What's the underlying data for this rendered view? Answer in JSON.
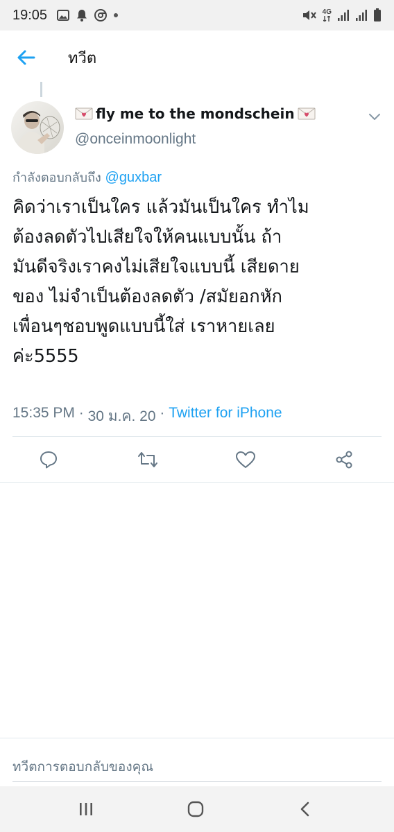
{
  "status_bar": {
    "time": "19:05",
    "network": "4G",
    "icons": [
      "image-icon",
      "bell-icon",
      "chrome-icon",
      "dot-icon",
      "mute-icon",
      "4g-icon",
      "signal-icon",
      "signal-icon",
      "battery-icon"
    ]
  },
  "header": {
    "title": "ทวีต",
    "back_icon": "arrow-left-icon"
  },
  "tweet": {
    "display_name": "fly me to the mondschein",
    "handle": "@onceinmoonlight",
    "reply_prefix": "กำลังตอบกลับถึง",
    "reply_mention": "@guxbar",
    "text_lines": [
      "คิดว่าเราเป็นใคร แล้วมันเป็นใคร ทำไม",
      "ต้องลดตัวไปเสียใจให้คนแบบนั้น ถ้า",
      "มันดีจริงเราคงไม่เสียใจแบบนี้ เสียดาย",
      "ของ ไม่จำเป็นต้องลดตัว /สมัยอกหัก",
      "เพื่อนๆชอบพูดแบบนี้ใส่ เราหายเลย",
      "ค่ะ5555"
    ],
    "time": "15:35 PM",
    "date": "30 ม.ค. 20",
    "separator": " · ",
    "source": "Twitter for iPhone"
  },
  "actions": [
    "reply-icon",
    "retweet-icon",
    "like-icon",
    "share-icon"
  ],
  "reply_box": {
    "placeholder": "ทวีตการตอบกลับของคุณ"
  },
  "nav_bar": [
    "recents-icon",
    "home-icon",
    "back-icon"
  ],
  "colors": {
    "accent": "#1da1f2",
    "secondary_text": "#657786",
    "primary_text": "#14171a",
    "divider": "#e1e8ed"
  }
}
